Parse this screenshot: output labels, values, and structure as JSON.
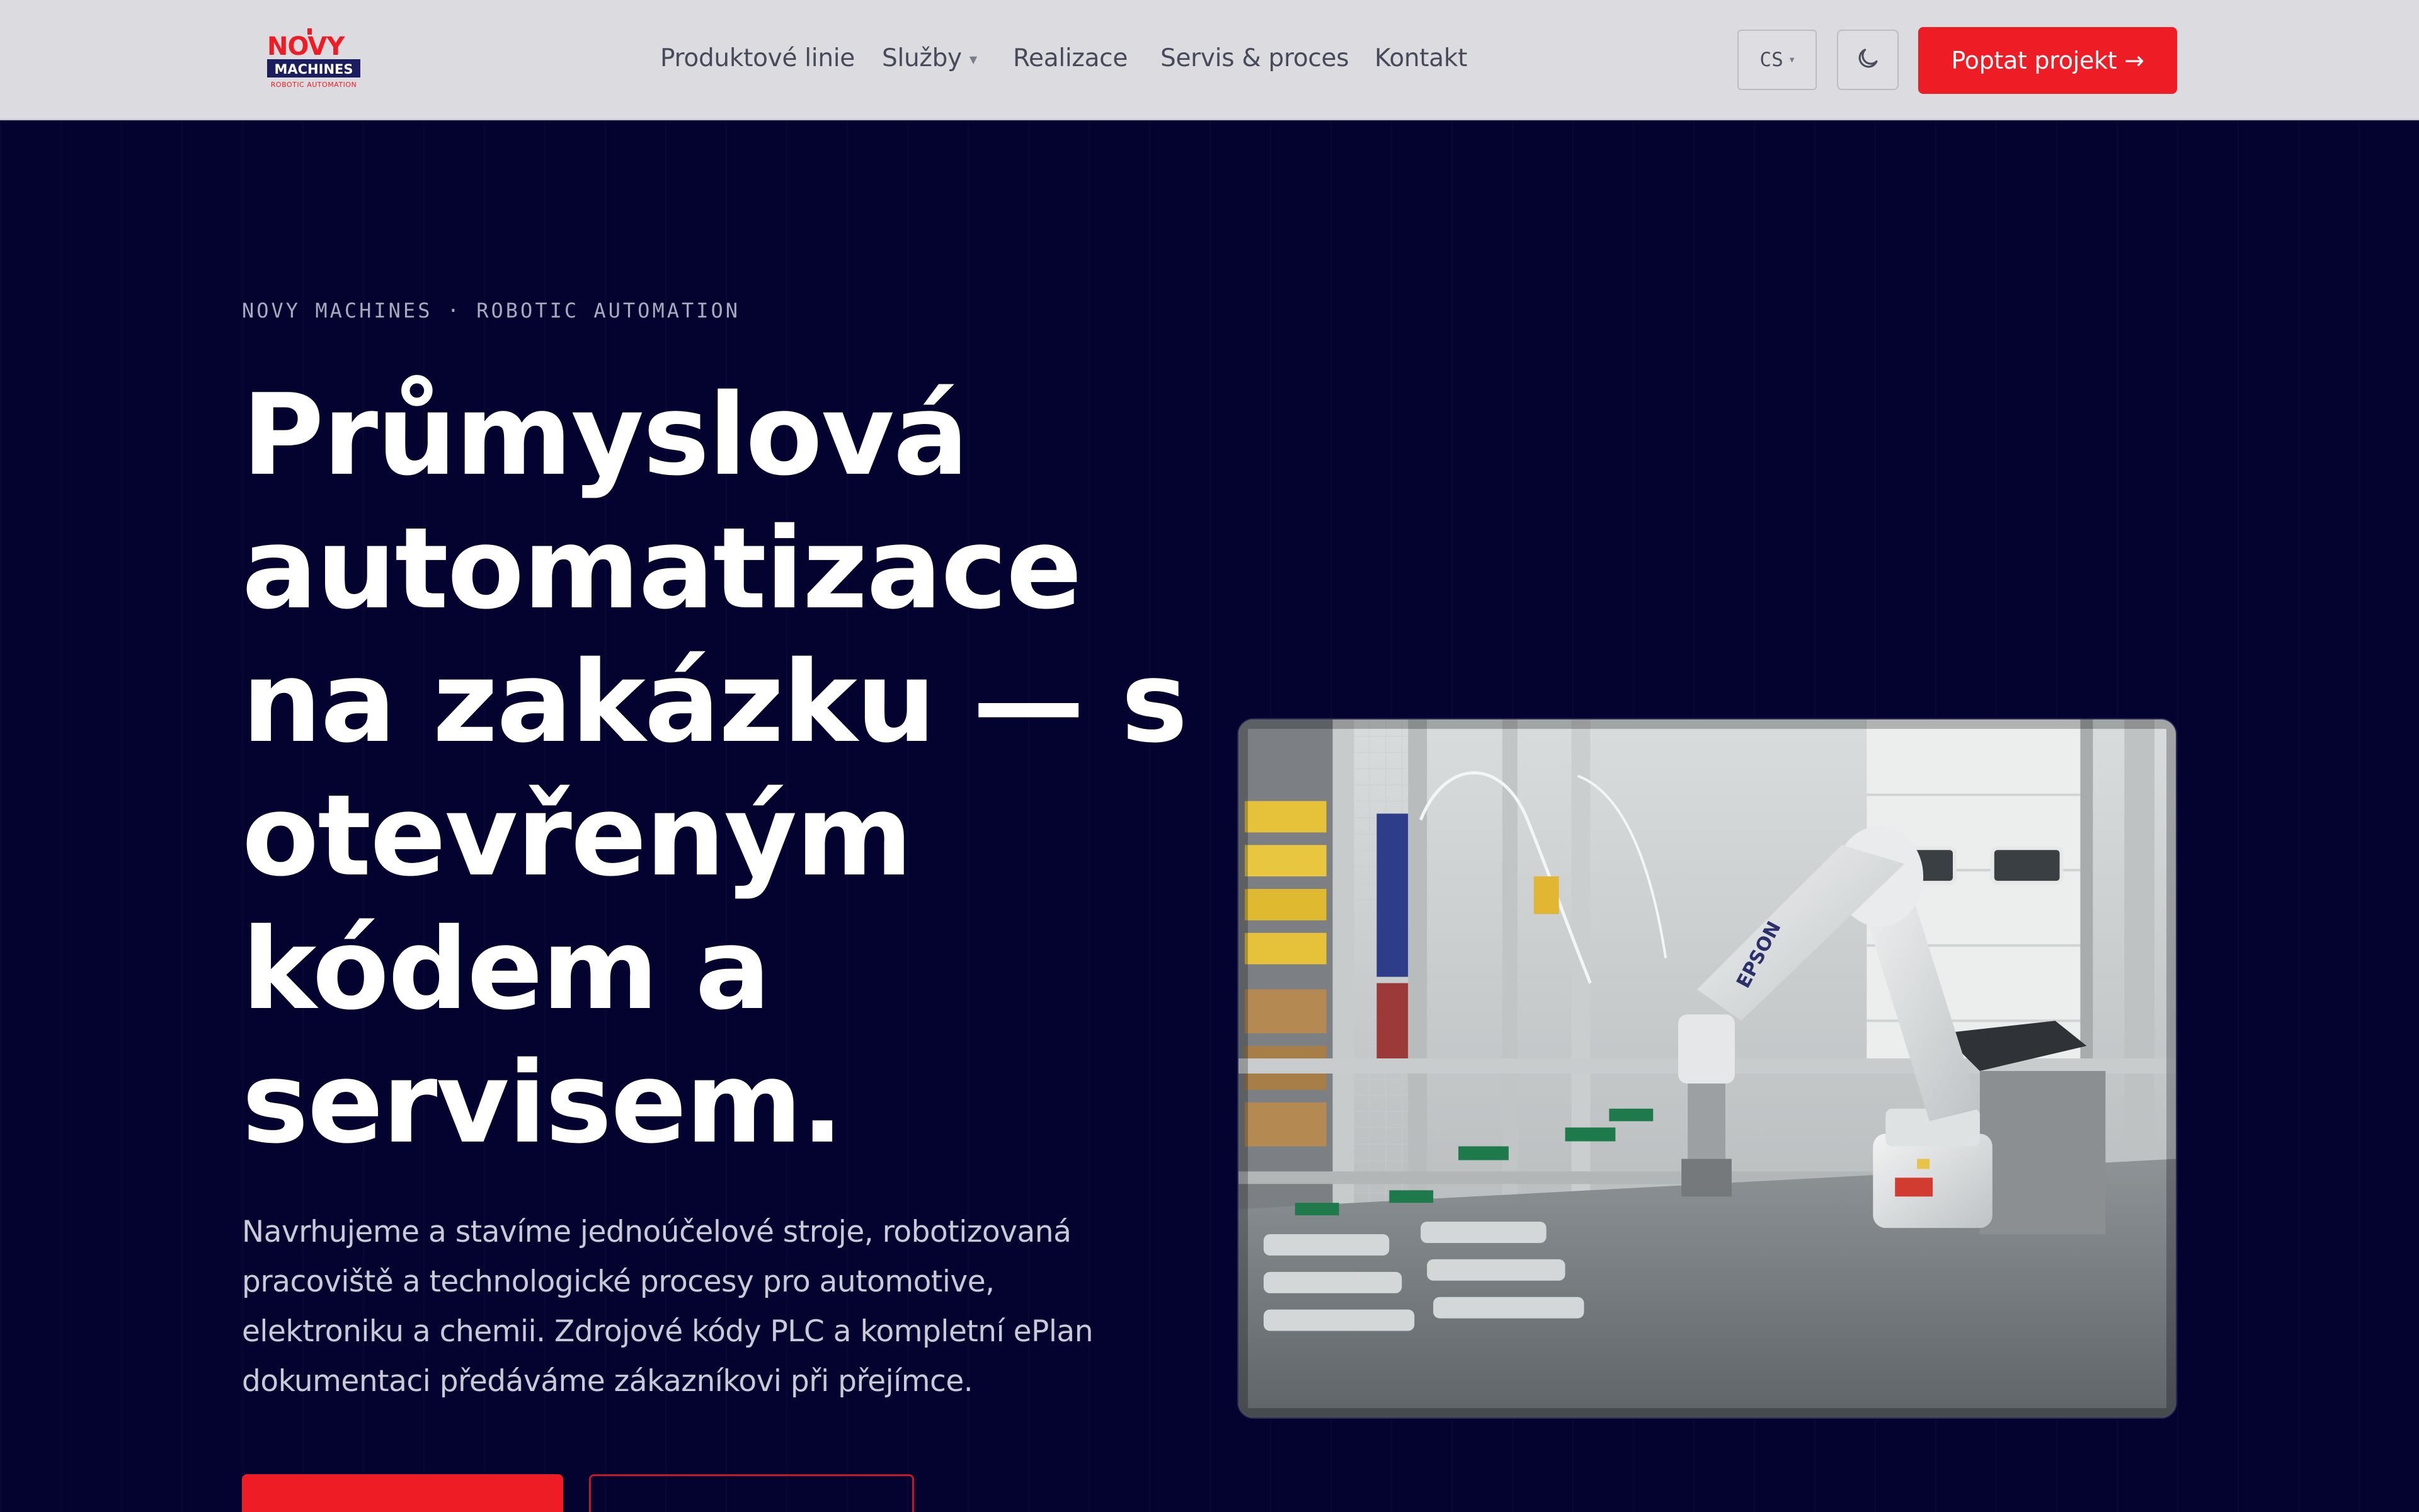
{
  "header": {
    "logo": {
      "top_text": "NOVY",
      "middle_text": "MACHINES",
      "bottom_text": "ROBOTIC AUTOMATION",
      "name": "novy-machines-logo"
    },
    "nav": [
      {
        "label": "Produktové linie"
      },
      {
        "label": "Služby",
        "has_dropdown": true
      },
      {
        "label": "Realizace"
      },
      {
        "label": "Servis & proces"
      },
      {
        "label": "Kontakt"
      }
    ],
    "language": "CS",
    "theme_icon": "moon-icon",
    "cta_label": "Poptat projekt →"
  },
  "hero": {
    "eyebrow": "NOVY MACHINES · ROBOTIC AUTOMATION",
    "headline_lines": [
      "Průmyslová",
      "automatizace",
      "na zakázku — s",
      "otevřeným",
      "kódem a",
      "servisem."
    ],
    "lead_lines": [
      "Navrhujeme a stavíme jednoúčelové stroje, robotizovaná",
      "pracoviště a technologické procesy pro automotive,",
      "elektroniku a chemii. Zdrojové kódy PLC a kompletní ePlan",
      "dokumentaci předáváme zákazníkovi při přejímce."
    ],
    "image_label": "EPSON"
  },
  "colors": {
    "header_bg": "#dcdbdf",
    "hero_bg": "#04032f",
    "accent_red": "#ee1c25",
    "nav_text": "#474a5a",
    "logo_navy": "#1b1e5e"
  }
}
